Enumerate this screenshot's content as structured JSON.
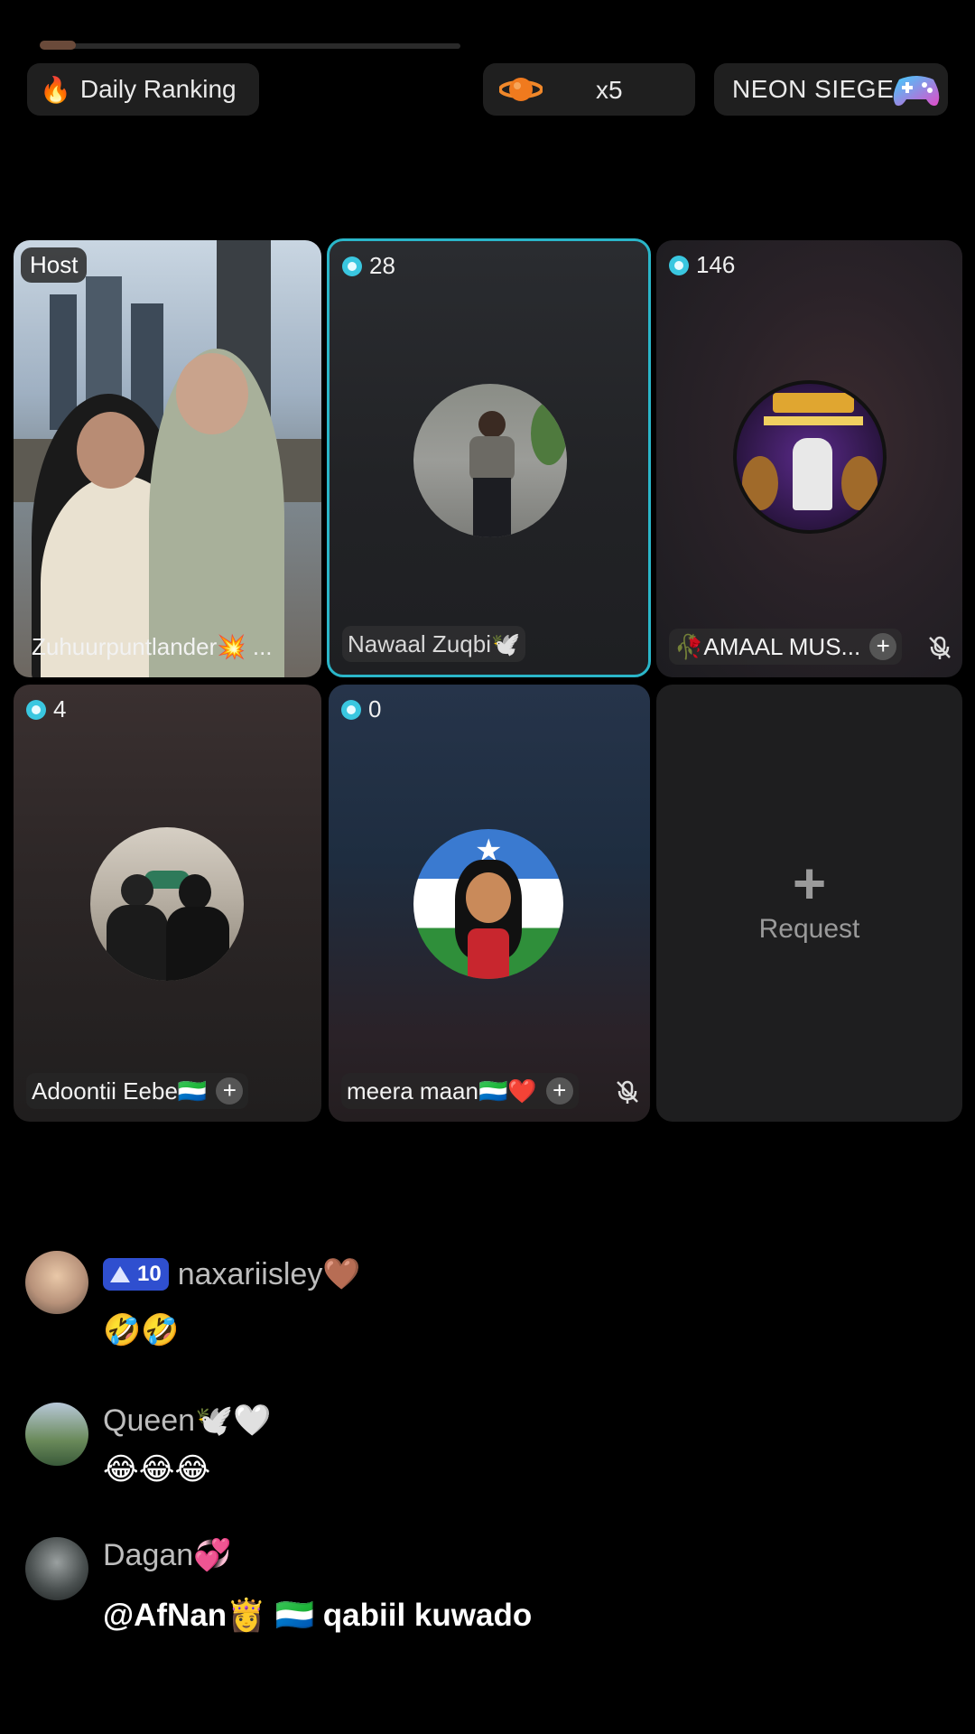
{
  "header": {
    "ranking_label": "Daily Ranking",
    "multiplier_label": "x5",
    "game_label": "NEON SIEGE"
  },
  "tiles": [
    {
      "role": "Host",
      "name": "Zuhuurpuntlander💥 ..."
    },
    {
      "score": "28",
      "name": "Nawaal Zuqbi🕊️"
    },
    {
      "score": "146",
      "name": "🥀AMAAL MUS...",
      "muted": true
    },
    {
      "score": "4",
      "name": "Adoontii Eebe🇸🇱"
    },
    {
      "score": "0",
      "name": "meera maan🇸🇱❤️",
      "muted": true
    },
    {
      "request_label": "Request"
    }
  ],
  "chat": [
    {
      "level": "10",
      "user": "naxariisley🤎",
      "text": "🤣🤣"
    },
    {
      "user": "Queen🕊️🤍",
      "text": "😂😂😂"
    },
    {
      "user": "Dagan💞",
      "text": "@AfNan👸 🇸🇱 qabiil kuwado"
    }
  ],
  "colors": {
    "selected_border": "#2ab6c9",
    "gem": "#3ac7e0",
    "level_badge": "#2f4fcf"
  }
}
